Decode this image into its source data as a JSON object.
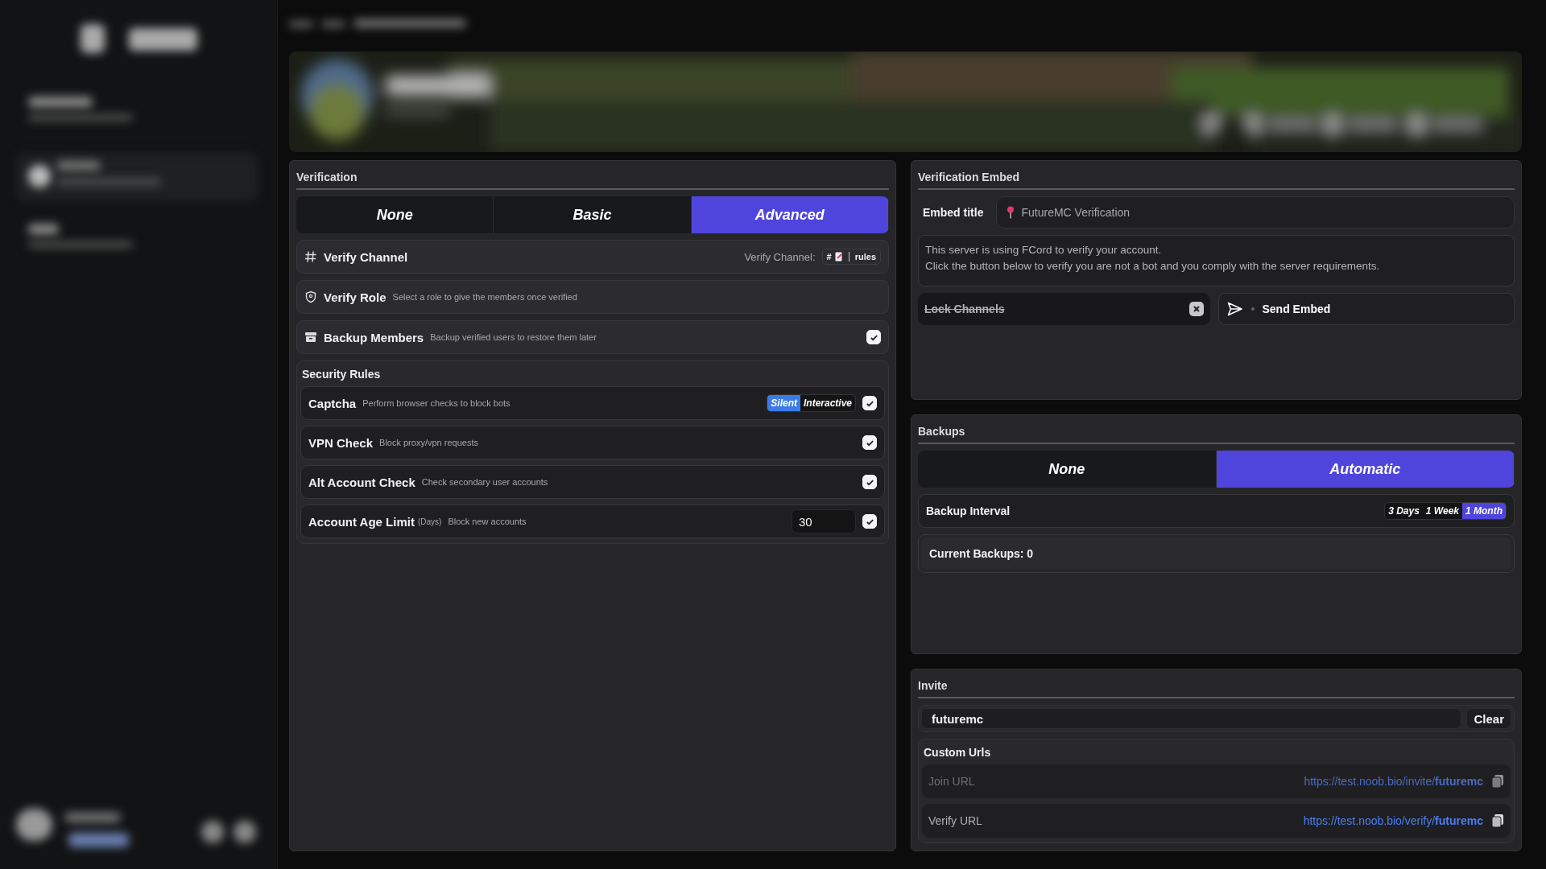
{
  "verification": {
    "title": "Verification",
    "modes": [
      {
        "label": "None",
        "selected": false
      },
      {
        "label": "Basic",
        "selected": false
      },
      {
        "label": "Advanced",
        "selected": true
      }
    ],
    "rows": [
      {
        "kind": "channel",
        "label": "Verify Channel",
        "hint": "Verify Channel:",
        "chip_prefix": "#",
        "chip_name": "rules"
      },
      {
        "kind": "role",
        "label": "Verify Role",
        "description": "Select a role to give the members once verified"
      },
      {
        "kind": "backup",
        "label": "Backup Members",
        "description": "Backup verified users to restore them later",
        "checked": true
      }
    ]
  },
  "security": {
    "title": "Security Rules",
    "rules": [
      {
        "kind": "options",
        "label": "Captcha",
        "description": "Perform browser checks to block bots",
        "options": [
          {
            "label": "Silent",
            "selected": true
          },
          {
            "label": "Interactive",
            "selected": false
          }
        ],
        "checked": true
      },
      {
        "kind": "plain",
        "label": "VPN Check",
        "description": "Block proxy/vpn requests",
        "checked": true
      },
      {
        "kind": "plain",
        "label": "Alt Account Check",
        "description": "Check secondary user accounts",
        "checked": true
      },
      {
        "kind": "number",
        "label": "Account Age Limit",
        "unit": "(Days)",
        "description": "Block new accounts",
        "value": "30",
        "checked": true
      }
    ]
  },
  "embed": {
    "title": "Verification Embed",
    "title_label": "Embed title",
    "title_value": "FutureMC Verification",
    "message": [
      "This server is using FCord to verify your account.",
      "Click the button below to verify you are not a bot and you comply with the server requirements."
    ],
    "lock_channels": {
      "label": "Lock Channels",
      "enabled": false
    },
    "send_button": "Send Embed"
  },
  "backups": {
    "title": "Backups",
    "modes": [
      {
        "label": "None",
        "selected": false
      },
      {
        "label": "Automatic",
        "selected": true
      }
    ],
    "interval": {
      "label": "Backup Interval",
      "options": [
        {
          "label": "3 Days",
          "selected": false
        },
        {
          "label": "1 Week",
          "selected": false
        },
        {
          "label": "1 Month",
          "selected": true
        }
      ]
    },
    "current": "Current Backups: 0"
  },
  "invite": {
    "title": "Invite",
    "code": "futuremc",
    "clear_button": "Clear",
    "custom_urls_title": "Custom Urls",
    "urls": [
      {
        "label": "Join URL",
        "url": "https://test.noob.bio/invite/**futuremc**",
        "disabled": true
      },
      {
        "label": "Verify URL",
        "url": "https://test.noob.bio/verify/**futuremc**",
        "disabled": false
      }
    ]
  }
}
